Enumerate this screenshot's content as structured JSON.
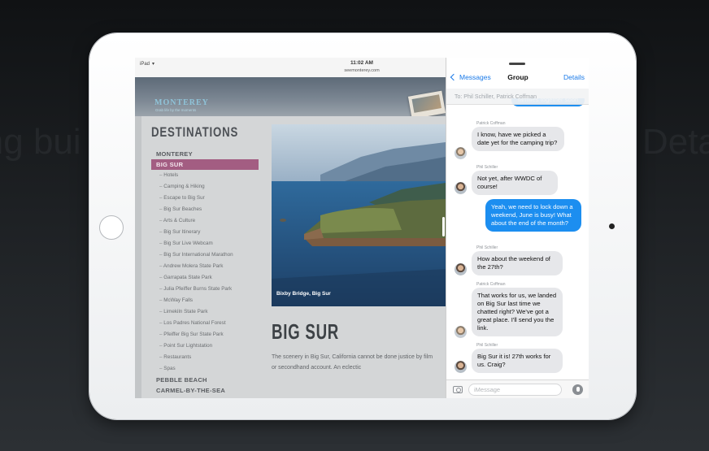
{
  "statusbar": {
    "carrier": "iPad",
    "time": "11:02 AM",
    "url": "seemonterey.com"
  },
  "site": {
    "logo": "MONTEREY",
    "tagline": "Grab life by the moments",
    "destinations_title": "DESTINATIONS",
    "nav_top": [
      {
        "label": "MONTEREY",
        "active": false
      },
      {
        "label": "BIG SUR",
        "active": true
      }
    ],
    "nav_sub": [
      "Hotels",
      "Camping & Hiking",
      "Escape to Big Sur",
      "Big Sur Beaches",
      "Arts & Culture",
      "Big Sur Itinerary",
      "Big Sur Live Webcam",
      "Big Sur International Marathon",
      "Andrew Molera State Park",
      "Garrapata State Park",
      "Julia Pfeiffer Burns State Park",
      "McWay Falls",
      "Limekiln State Park",
      "Los Padres National Forest",
      "Pfeiffer Big Sur State Park",
      "Point Sur Lightstation",
      "Restaurants",
      "Spas"
    ],
    "nav_bottom": [
      {
        "label": "PEBBLE BEACH"
      },
      {
        "label": "CARMEL-BY-THE-SEA"
      }
    ],
    "hero_caption": "Bixby Bridge, Big Sur",
    "article_title": "BIG SUR",
    "article_body": "The scenery in Big Sur, California cannot be done justice by film or secondhand account. An eclectic"
  },
  "messages": {
    "back_label": "Messages",
    "title": "Group",
    "details_label": "Details",
    "to_line": "To: Phil Schiller, Patrick Coffman",
    "thread": [
      {
        "dir": "out",
        "text": "families together soon"
      },
      {
        "dir": "in",
        "sender": "Patrick Coffman",
        "text": "I know, have we picked a date yet for the camping trip?"
      },
      {
        "dir": "in",
        "sender": "Phil Schiller",
        "text": "Not yet, after WWDC of course!"
      },
      {
        "dir": "out",
        "text": "Yeah, we need to lock down a weekend, June is busy! What about the end of the month?"
      },
      {
        "dir": "in",
        "sender": "Phil Schiller",
        "text": "How about the weekend of the 27th?"
      },
      {
        "dir": "in",
        "sender": "Patrick Coffman",
        "text": "That works for us, we landed on Big Sur last time we chatted right? We've got a great place. I'll send you the link."
      },
      {
        "dir": "in",
        "sender": "Phil Schiller",
        "text": "Big Sur it is! 27th works for us. Craig?"
      }
    ],
    "compose_placeholder": "iMessage"
  },
  "colors": {
    "accent_blue": "#1a7ae8",
    "outgoing_bubble": "#1c8ef0",
    "incoming_bubble": "#e6e7ea",
    "nav_active": "#a35d82"
  }
}
